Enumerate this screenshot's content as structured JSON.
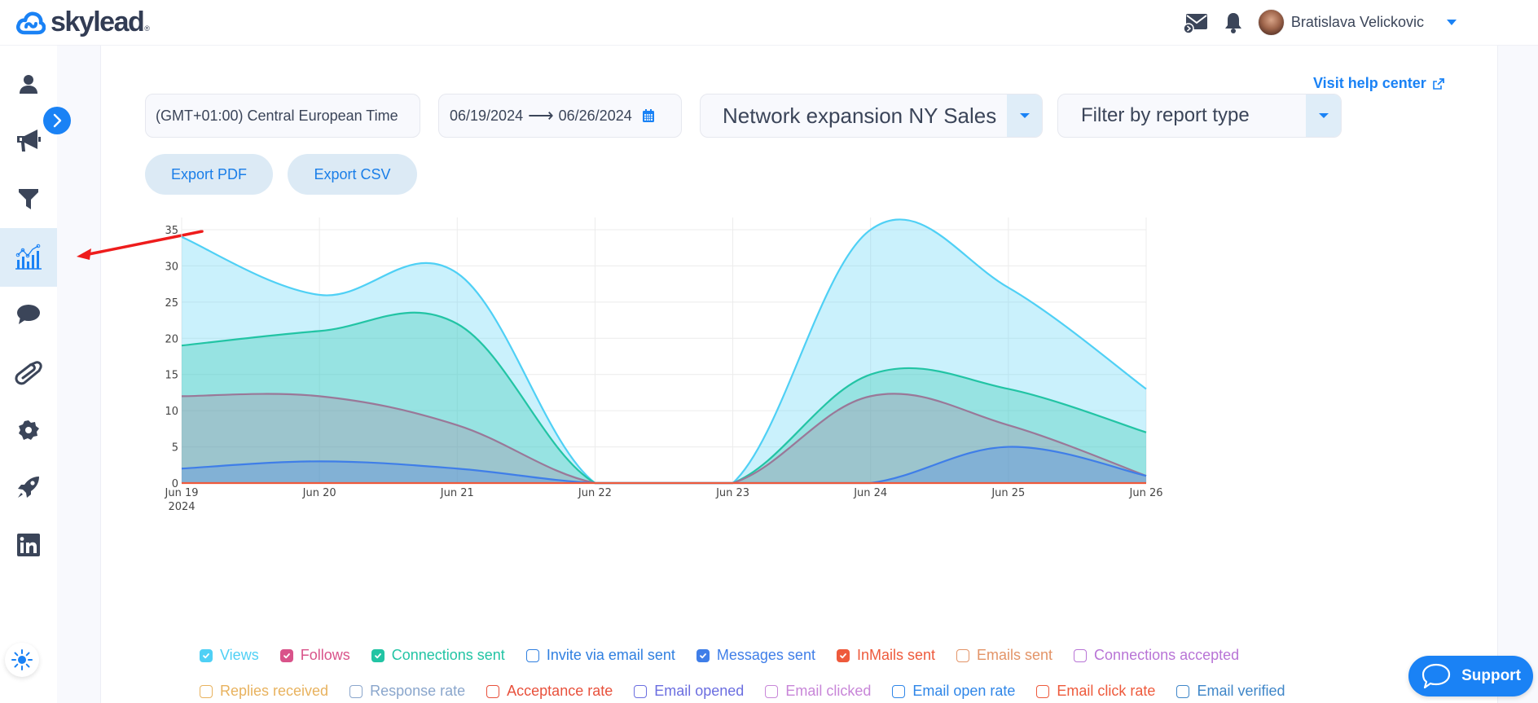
{
  "brand": {
    "name": "skylead",
    "registered_mark": "®",
    "accent": "#1a82f5"
  },
  "header": {
    "user_name": "Bratislava Velickovic",
    "icons": [
      "email-campaign-icon",
      "bell-icon",
      "avatar",
      "chevron-down-icon"
    ]
  },
  "sidebar": {
    "items": [
      {
        "name": "contacts",
        "icon": "user-icon",
        "active": false
      },
      {
        "name": "campaigns",
        "icon": "megaphone-icon",
        "active": false
      },
      {
        "name": "filters",
        "icon": "funnel-icon",
        "active": false
      },
      {
        "name": "reports",
        "icon": "chart-icon",
        "active": true
      },
      {
        "name": "inbox",
        "icon": "chat-bubble-icon",
        "active": false
      },
      {
        "name": "integrations",
        "icon": "paperclip-icon",
        "active": false
      },
      {
        "name": "settings",
        "icon": "gear-icon",
        "active": false
      },
      {
        "name": "onboarding",
        "icon": "rocket-icon",
        "active": false
      },
      {
        "name": "linkedin-accounts",
        "icon": "linkedin-icon",
        "active": false
      }
    ],
    "theme_toggle_icon": "sun-icon",
    "expand_icon": "chevron-right-icon"
  },
  "controls": {
    "help_link": "Visit help center",
    "timezone": "(GMT+01:00) Central European Time",
    "date_from": "06/19/2024",
    "date_arrow": "⟶",
    "date_to": "06/26/2024",
    "campaign_select": "Network expansion NY Sales",
    "report_type_placeholder": "Filter by report type",
    "export_pdf": "Export PDF",
    "export_csv": "Export CSV"
  },
  "legend": {
    "row1": [
      {
        "label": "Views",
        "color": "#4fd0f5",
        "checked": true
      },
      {
        "label": "Follows",
        "color": "#d9538a",
        "checked": true
      },
      {
        "label": "Connections sent",
        "color": "#22c4a4",
        "checked": true
      },
      {
        "label": "Invite via email sent",
        "color": "#2f7fe0",
        "checked": false
      },
      {
        "label": "Messages sent",
        "color": "#3f7ee8",
        "checked": true
      },
      {
        "label": "InMails sent",
        "color": "#ee5a3c",
        "checked": true
      },
      {
        "label": "Emails sent",
        "color": "#e39468",
        "checked": false
      },
      {
        "label": "Connections accepted",
        "color": "#b874d6",
        "checked": false
      }
    ],
    "row2": [
      {
        "label": "Replies received",
        "color": "#e8b25e",
        "checked": false
      },
      {
        "label": "Response rate",
        "color": "#8aa6cc",
        "checked": false
      },
      {
        "label": "Acceptance rate",
        "color": "#e8513c",
        "checked": false
      },
      {
        "label": "Email opened",
        "color": "#6b6ee0",
        "checked": false
      },
      {
        "label": "Email clicked",
        "color": "#c886d8",
        "checked": false
      },
      {
        "label": "Email open rate",
        "color": "#2f86e8",
        "checked": false
      },
      {
        "label": "Email click rate",
        "color": "#ee5a3c",
        "checked": false
      },
      {
        "label": "Email verified",
        "color": "#3f86c8",
        "checked": false
      }
    ]
  },
  "support": {
    "label": "Support"
  },
  "chart_data": {
    "type": "area",
    "title": "",
    "xlabel": "",
    "ylabel": "",
    "x": [
      "Jun 19",
      "Jun 20",
      "Jun 21",
      "Jun 22",
      "Jun 23",
      "Jun 24",
      "Jun 25",
      "Jun 26"
    ],
    "x_year_label": "2024",
    "ylim": [
      0,
      35
    ],
    "yticks": [
      0,
      5,
      10,
      15,
      20,
      25,
      30,
      35
    ],
    "grid": true,
    "smoothing": "spline",
    "series": [
      {
        "name": "Views",
        "color": "#4fd0f5",
        "fill": "rgba(79,208,245,0.30)",
        "values": [
          34,
          26,
          29,
          0,
          0,
          35,
          27,
          13
        ]
      },
      {
        "name": "Connections sent",
        "color": "#22c4a4",
        "fill": "rgba(34,196,164,0.30)",
        "values": [
          19,
          21,
          22,
          0,
          0,
          15,
          13,
          7
        ]
      },
      {
        "name": "Follows",
        "color": "#9a7898",
        "fill": "rgba(170,120,150,0.28)",
        "values": [
          12,
          12,
          8,
          0,
          0,
          12,
          8,
          1
        ]
      },
      {
        "name": "Messages sent",
        "color": "#3f7ee8",
        "fill": "rgba(63,126,232,0.28)",
        "values": [
          2,
          3,
          2,
          0,
          0,
          0,
          5,
          1
        ]
      },
      {
        "name": "InMails sent",
        "color": "#ee5a3c",
        "fill": "rgba(238,90,60,0.2)",
        "values": [
          0,
          0,
          0,
          0,
          0,
          0,
          0,
          0
        ]
      }
    ]
  }
}
